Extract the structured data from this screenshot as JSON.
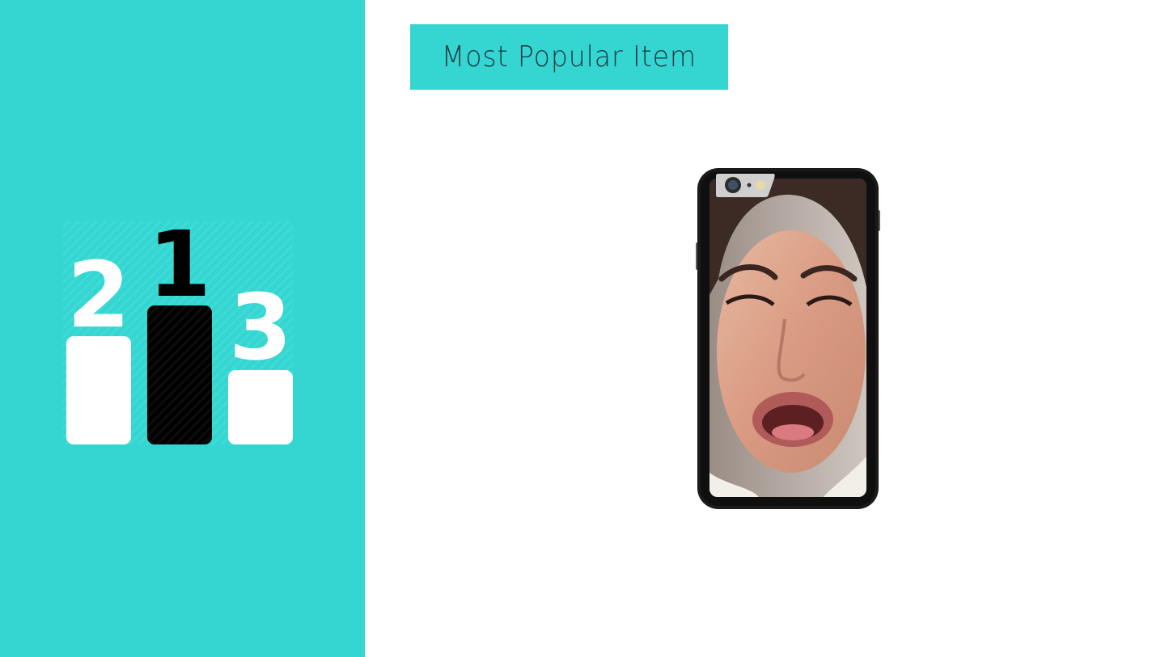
{
  "slide": {
    "title": "Most Popular Item",
    "accent_color": "#35d6d1"
  },
  "podium": {
    "icon": "podium-icon",
    "places": [
      "2",
      "1",
      "3"
    ]
  },
  "product": {
    "icon": "phone-case-image"
  }
}
